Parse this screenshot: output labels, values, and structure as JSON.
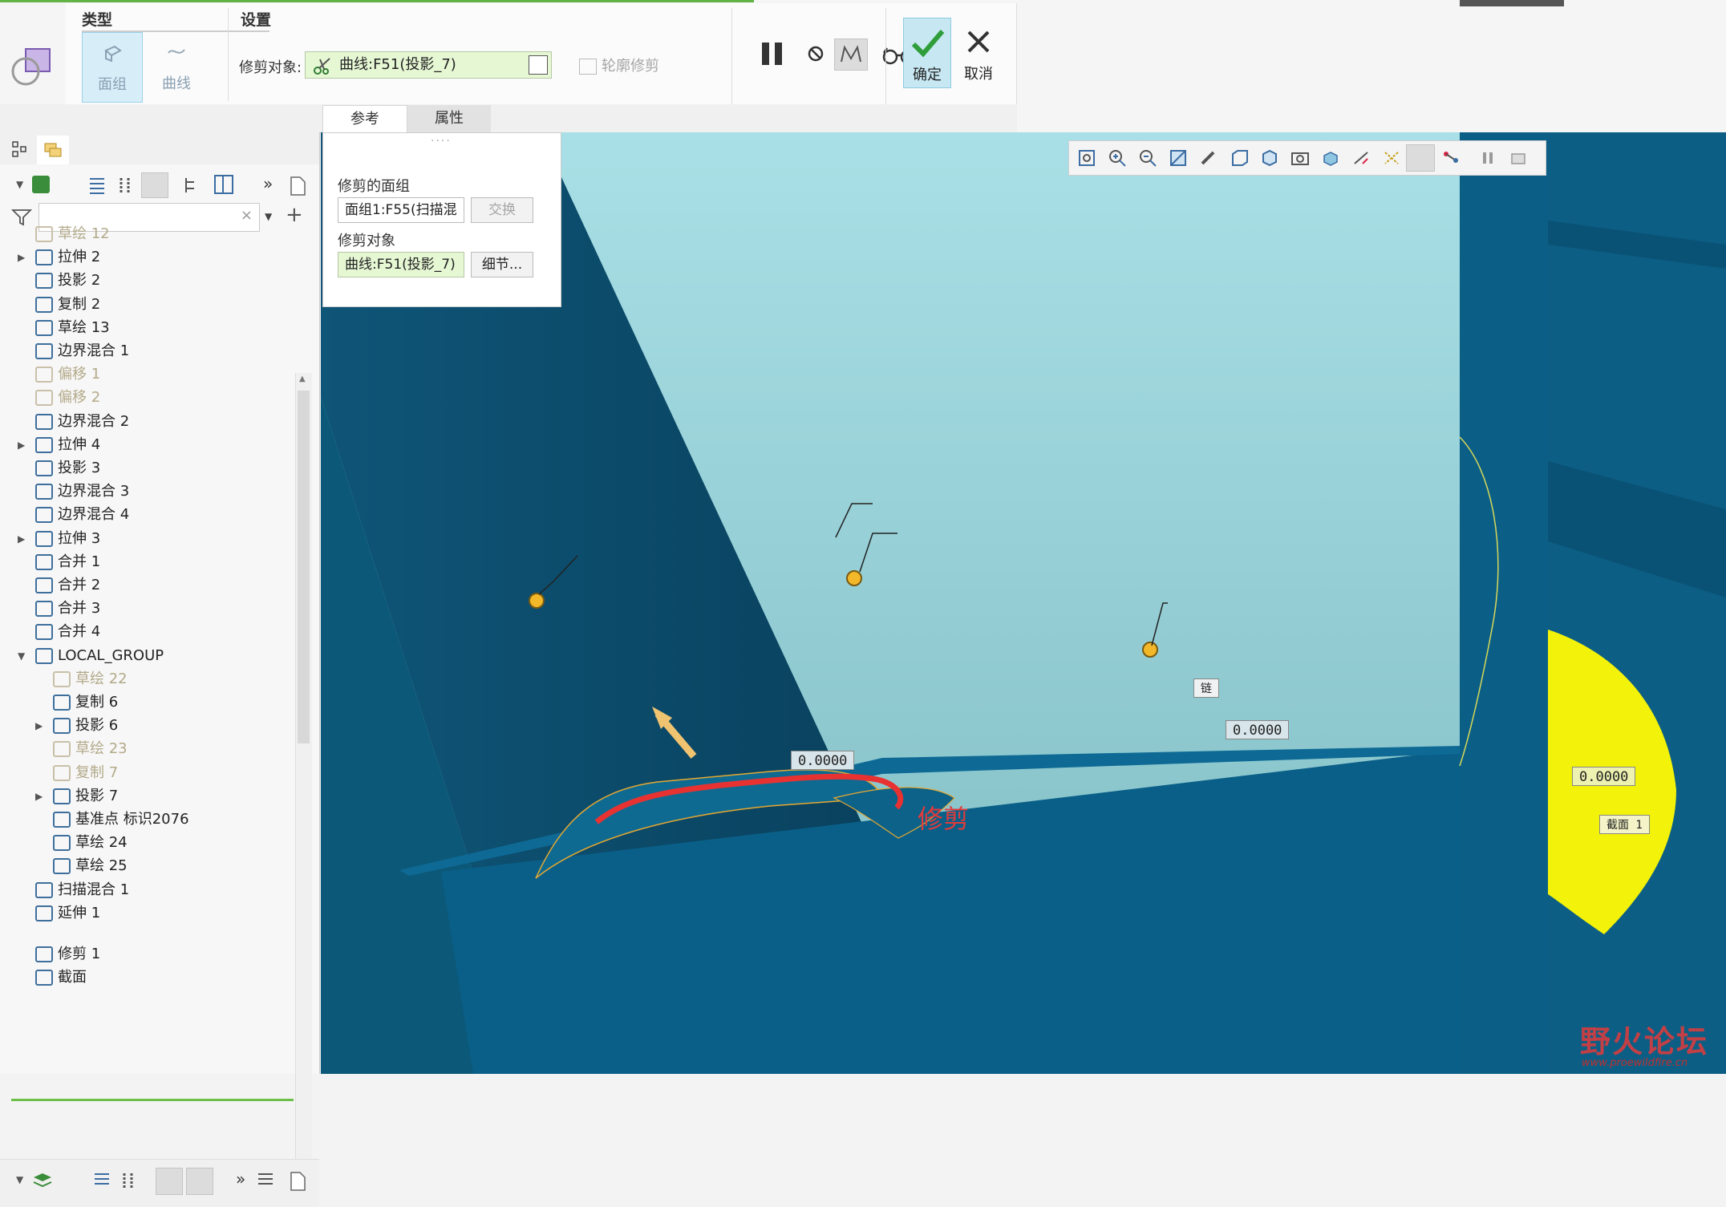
{
  "ribbon": {
    "type_group_title": "类型",
    "type_buttons": [
      "面组",
      "曲线"
    ],
    "settings_group_title": "设置",
    "trim_object_label": "修剪对象:",
    "trim_object_value": "曲线:F51(投影_7)",
    "contour_trim_label": "轮廓修剪",
    "confirm_label": "确定",
    "cancel_label": "取消",
    "tabs": [
      "参考",
      "属性"
    ]
  },
  "reference_panel": {
    "trimmed_quilt_label": "修剪的面组",
    "trimmed_quilt_value": "面组1:F55(扫描混",
    "swap_button": "交换",
    "trim_object_label": "修剪对象",
    "trim_object_value": "曲线:F51(投影_7)",
    "details_button": "细节..."
  },
  "model_tree": {
    "items": [
      {
        "label": "草绘 12",
        "dim": true
      },
      {
        "label": "拉伸 2",
        "dim": false
      },
      {
        "label": "投影 2",
        "dim": false
      },
      {
        "label": "复制 2",
        "dim": false
      },
      {
        "label": "草绘 13",
        "dim": false
      },
      {
        "label": "边界混合 1",
        "dim": false
      },
      {
        "label": "偏移 1",
        "dim": true
      },
      {
        "label": "偏移 2",
        "dim": true
      },
      {
        "label": "边界混合 2",
        "dim": false
      },
      {
        "label": "拉伸 4",
        "dim": false
      },
      {
        "label": "投影 3",
        "dim": false
      },
      {
        "label": "边界混合 3",
        "dim": false
      },
      {
        "label": "边界混合 4",
        "dim": false
      },
      {
        "label": "拉伸 3",
        "dim": false
      },
      {
        "label": "合并 1",
        "dim": false
      },
      {
        "label": "合并 2",
        "dim": false
      },
      {
        "label": "合并 3",
        "dim": false
      },
      {
        "label": "合并 4",
        "dim": false
      },
      {
        "label": "LOCAL_GROUP",
        "dim": false
      },
      {
        "label": "草绘 22",
        "dim": true
      },
      {
        "label": "复制 6",
        "dim": false
      },
      {
        "label": "投影 6",
        "dim": false
      },
      {
        "label": "草绘 23",
        "dim": true
      },
      {
        "label": "复制 7",
        "dim": true
      },
      {
        "label": "投影 7",
        "dim": false
      },
      {
        "label": "基准点 标识2076",
        "dim": false
      },
      {
        "label": "草绘 24",
        "dim": false
      },
      {
        "label": "草绘 25",
        "dim": false
      },
      {
        "label": "扫描混合 1",
        "dim": false
      },
      {
        "label": "延伸 1",
        "dim": false
      },
      {
        "label": "修剪 1",
        "dim": false
      },
      {
        "label": "截面",
        "dim": false
      }
    ]
  },
  "viewport": {
    "dim_left": "0.0000",
    "dim_right": "0.0000",
    "dim_far_right": "0.0000",
    "chain_tag": "链",
    "section_tag": "截面 1",
    "annotation_text": "修剪"
  },
  "watermark": {
    "text": "野火论坛",
    "url": "www.proewildfire.cn"
  },
  "colors": {
    "accent_green": "#62b245",
    "confirm_bg": "#c7e8f3",
    "surface_dark": "#0a4d6e",
    "surface_mid": "#0e5f86",
    "background_sky": "#9fd7e0",
    "trim_curve": "#e83232",
    "highlight_yellow": "#f2f20a",
    "annotation_red": "#e23b3b"
  }
}
